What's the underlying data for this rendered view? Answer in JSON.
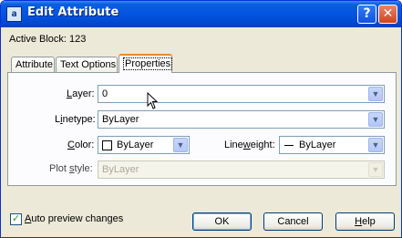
{
  "window": {
    "title": "Edit Attribute",
    "icon": "app-icon",
    "icon_glyph": "a",
    "help_glyph": "?",
    "close_glyph": "✕"
  },
  "active_block": "Active Block: 123",
  "tabs": [
    {
      "label": "Attribute",
      "selected": false
    },
    {
      "label": "Text Options",
      "selected": false
    },
    {
      "label": "Properties",
      "selected": true
    }
  ],
  "properties": {
    "layer": {
      "label_underlined": "L",
      "label_rest": "ayer:",
      "value": "0"
    },
    "linetype": {
      "label_pre": "L",
      "label_underlined": "i",
      "label_rest": "netype:",
      "value": "ByLayer"
    },
    "color": {
      "label_underlined": "C",
      "label_rest": "olor:",
      "value": "ByLayer",
      "swatch_color": "#ffffff"
    },
    "lineweight": {
      "label_pre": "Line",
      "label_underlined": "w",
      "label_rest": "eight:",
      "value": "ByLayer"
    },
    "plot_style": {
      "label_pre": "Plot ",
      "label_underlined": "s",
      "label_rest": "tyle:",
      "value": "ByLayer",
      "disabled": true
    }
  },
  "auto_preview": {
    "checked": true,
    "label_underlined": "A",
    "label_rest": "uto preview changes",
    "check_glyph": "✓"
  },
  "buttons": {
    "ok": "OK",
    "cancel": "Cancel",
    "help_underlined": "H",
    "help_rest": "elp"
  },
  "dropdown_glyph": "▼",
  "colors": {
    "titlebar": "#0454e0",
    "dialog_bg": "#ece9d8",
    "selected_tab_accent": "#e68b2c",
    "close_button": "#d2431c"
  }
}
